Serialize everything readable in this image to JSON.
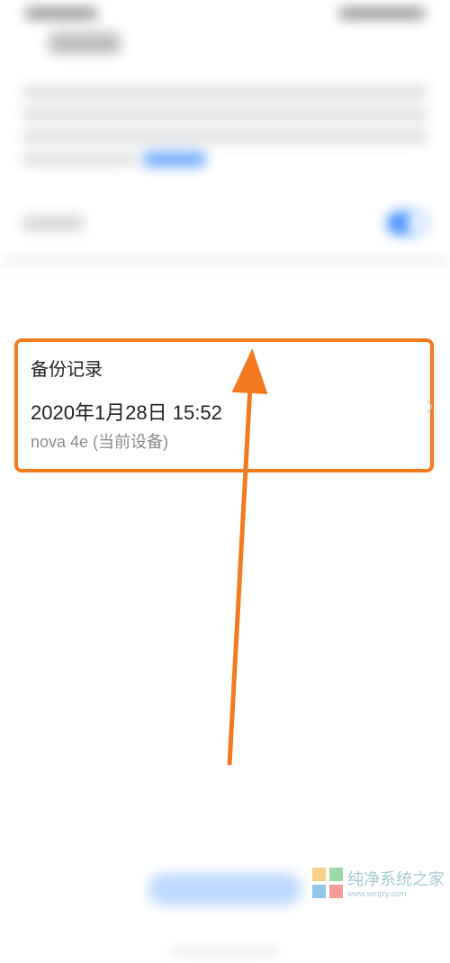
{
  "backup_record": {
    "section_title": "备份记录",
    "timestamp": "2020年1月28日 15:52",
    "device": "nova 4e (当前设备)"
  },
  "watermark": {
    "main": "纯净系统之家",
    "sub": "www.wmjzy.com"
  }
}
